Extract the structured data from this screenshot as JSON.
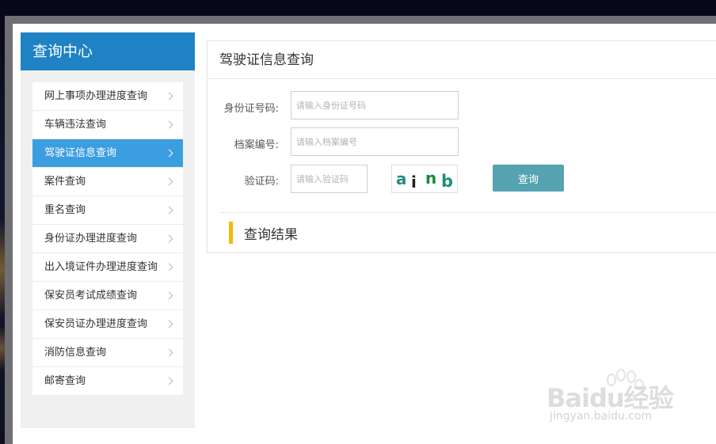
{
  "sidebar": {
    "title": "查询中心",
    "items": [
      {
        "label": "网上事项办理进度查询"
      },
      {
        "label": "车辆违法查询"
      },
      {
        "label": "驾驶证信息查询"
      },
      {
        "label": "案件查询"
      },
      {
        "label": "重名查询"
      },
      {
        "label": "身份证办理进度查询"
      },
      {
        "label": "出入境证件办理进度查询"
      },
      {
        "label": "保安员考试成绩查询"
      },
      {
        "label": "保安员证办理进度查询"
      },
      {
        "label": "消防信息查询"
      },
      {
        "label": "邮寄查询"
      }
    ],
    "active_index": 2
  },
  "main": {
    "title": "驾驶证信息查询",
    "form": {
      "id_label": "身份证号码:",
      "id_placeholder": "请输入身份证号码",
      "id_value": "",
      "file_label": "档案编号:",
      "file_placeholder": "请输入档案编号",
      "file_value": "",
      "captcha_label": "验证码:",
      "captcha_placeholder": "请输入验证码",
      "captcha_value": "",
      "captcha_chars": [
        "a",
        "i",
        "n",
        "b"
      ]
    },
    "query_button": "查询",
    "result_title": "查询结果"
  },
  "watermark": {
    "brand": "Baidu经验",
    "url": "jingyan.baidu.com"
  },
  "colors": {
    "header_blue": "#1e82c4",
    "active_blue": "#3b9ee0",
    "button_teal": "#55a3b0",
    "result_accent": "#f5b800"
  }
}
